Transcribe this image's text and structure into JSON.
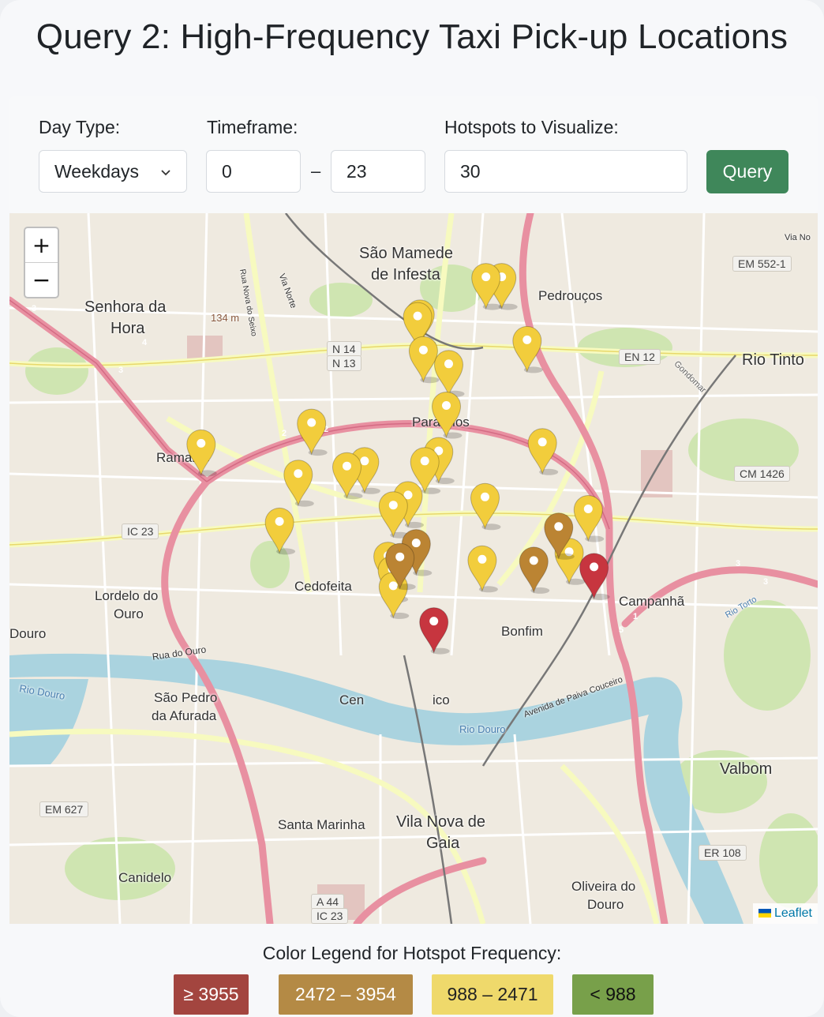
{
  "title": "Query 2: High-Frequency Taxi Pick-up Locations",
  "controls": {
    "day_type_label": "Day Type:",
    "day_type_value": "Weekdays",
    "timeframe_label": "Timeframe:",
    "timeframe_from": "0",
    "timeframe_separator": "–",
    "timeframe_to": "23",
    "hotspots_label": "Hotspots to Visualize:",
    "hotspots_value": "30",
    "query_button": "Query"
  },
  "map": {
    "zoom_in": "+",
    "zoom_out": "−",
    "attribution": "Leaflet",
    "places": {
      "sao_mamede_1": "São Mamede",
      "sao_mamede_2": "de Infesta",
      "senhora_1": "Senhora da",
      "senhora_2": "Hora",
      "pedroucos": "Pedrouços",
      "rio_tinto": "Rio Tinto",
      "paranhos": "Paranhos",
      "ramalde": "Ramalde",
      "cedofeita": "Cedofeita",
      "lordelo_1": "Lordelo do",
      "lordelo_2": "Ouro",
      "campanha": "Campanhã",
      "bonfim": "Bonfim",
      "douro": "Douro",
      "centro_partial": "Cen",
      "ico_partial": "ico",
      "sao_pedro_1": "São Pedro",
      "sao_pedro_2": "da Afurada",
      "valbom": "Valbom",
      "santa_marinha": "Santa Marinha",
      "vng_1": "Vila Nova de",
      "vng_2": "Gaia",
      "canidelo": "Canidelo",
      "oliveira_1": "Oliveira do",
      "oliveira_2": "Douro",
      "elevation": "134 m",
      "gondomar": "Gondomar",
      "rio_douro_1": "Rio Douro",
      "rio_douro_2": "Rio Douro",
      "rio_torto": "Rio Torto",
      "rua_do_ouro": "Rua do Ouro",
      "avenida_paiva": "Avenida de Paiva Couceiro",
      "via_norte": "Via Norte",
      "rua_nova": "Rua Nova do Seixo",
      "via_no": "Via No"
    },
    "road_labels": [
      "EM 552-1",
      "N 14",
      "N 13",
      "EN 12",
      "CM 1426",
      "IC 23",
      "EM 627",
      "ER 108",
      "A 44",
      "IC 23"
    ],
    "route_numbers": [
      "2",
      "2",
      "3",
      "3",
      "4",
      "5",
      "3",
      "1",
      "3"
    ]
  },
  "markers": [
    {
      "level": "medium",
      "lon": -8.6247,
      "lat": 41.2012
    },
    {
      "level": "medium",
      "lon": -8.6242,
      "lat": 41.2016
    },
    {
      "level": "medium",
      "lon": -8.6235,
      "lat": 41.1958
    },
    {
      "level": "medium",
      "lon": -8.6182,
      "lat": 41.1936
    },
    {
      "level": "medium",
      "lon": -8.6018,
      "lat": 41.1974
    },
    {
      "level": "medium",
      "lon": -8.6071,
      "lat": 41.2074
    },
    {
      "level": "medium",
      "lon": -8.6104,
      "lat": 41.2074
    },
    {
      "level": "medium",
      "lon": -8.6187,
      "lat": 41.187
    },
    {
      "level": "medium",
      "lon": -8.6203,
      "lat": 41.1798
    },
    {
      "level": "medium",
      "lon": -8.6232,
      "lat": 41.1782
    },
    {
      "level": "medium",
      "lon": -8.6358,
      "lat": 41.1782
    },
    {
      "level": "medium",
      "lon": -8.6395,
      "lat": 41.1774
    },
    {
      "level": "medium",
      "lon": -8.6469,
      "lat": 41.1843
    },
    {
      "level": "medium",
      "lon": -8.6497,
      "lat": 41.1762
    },
    {
      "level": "medium",
      "lon": -8.67,
      "lat": 41.181
    },
    {
      "level": "medium",
      "lon": -8.6536,
      "lat": 41.1686
    },
    {
      "level": "medium",
      "lon": -8.6298,
      "lat": 41.1712
    },
    {
      "level": "medium",
      "lon": -8.6267,
      "lat": 41.1728
    },
    {
      "level": "medium",
      "lon": -8.6106,
      "lat": 41.1725
    },
    {
      "level": "medium",
      "lon": -8.6112,
      "lat": 41.1626
    },
    {
      "level": "medium",
      "lon": -8.593,
      "lat": 41.1638
    },
    {
      "level": "medium",
      "lon": -8.589,
      "lat": 41.1706
    },
    {
      "level": "medium",
      "lon": -8.5986,
      "lat": 41.1812
    },
    {
      "level": "medium",
      "lon": -8.63,
      "lat": 41.161
    },
    {
      "level": "medium",
      "lon": -8.6298,
      "lat": 41.1584
    },
    {
      "level": "medium",
      "lon": -8.6309,
      "lat": 41.1632
    },
    {
      "level": "high",
      "lon": -8.5952,
      "lat": 41.1678
    },
    {
      "level": "high",
      "lon": -8.6284,
      "lat": 41.163
    },
    {
      "level": "high",
      "lon": -8.625,
      "lat": 41.1652
    },
    {
      "level": "high",
      "lon": -8.6004,
      "lat": 41.1624
    },
    {
      "level": "very_high",
      "lon": -8.6213,
      "lat": 41.1528
    },
    {
      "level": "very_high",
      "lon": -8.5878,
      "lat": 41.1614
    }
  ],
  "legend": {
    "title": "Color Legend for Hotspot Frequency:",
    "items": [
      {
        "label": "≥ 3955",
        "color": "#a3453f",
        "text_color": "#ffffff",
        "level": "very_high"
      },
      {
        "label": "2472 – 3954",
        "color": "#b48a45",
        "text_color": "#ffffff",
        "level": "high"
      },
      {
        "label": "988 – 2471",
        "color": "#efd96b",
        "text_color": "#222222",
        "level": "medium"
      },
      {
        "label": "< 988",
        "color": "#78a04a",
        "text_color": "#111111",
        "level": "low"
      }
    ]
  },
  "colors": {
    "very_high": "#c7353f",
    "high": "#bb8433",
    "medium": "#f2cd3c",
    "low": "#78a04a",
    "query_button": "#3f875a"
  }
}
